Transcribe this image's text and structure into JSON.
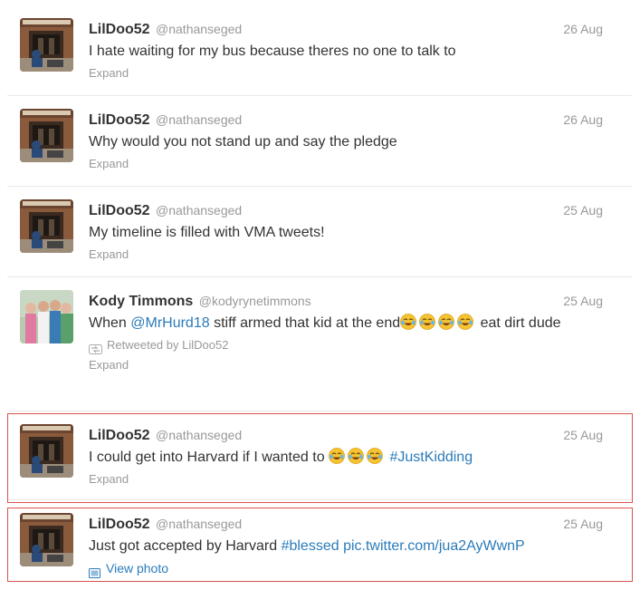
{
  "tweets": [
    {
      "fullname": "LilDoo52",
      "username": "@nathanseged",
      "time": "26 Aug",
      "text": "I hate waiting for my bus because theres no one to talk to",
      "action": "Expand"
    },
    {
      "fullname": "LilDoo52",
      "username": "@nathanseged",
      "time": "26 Aug",
      "text": "Why would you not stand up and say the pledge",
      "action": "Expand"
    },
    {
      "fullname": "LilDoo52",
      "username": "@nathanseged",
      "time": "25 Aug",
      "text": "My timeline is filled with VMA tweets!",
      "action": "Expand"
    },
    {
      "fullname": "Kody Timmons",
      "username": "@kodyrynetimmons",
      "time": "25 Aug",
      "text_before": "When ",
      "mention": "@MrHurd18",
      "text_after": " stiff armed that kid at the end",
      "text_tail": " eat dirt dude",
      "retweeted_by": "Retweeted by LilDoo52",
      "action": "Expand"
    },
    {
      "fullname": "LilDoo52",
      "username": "@nathanseged",
      "time": "25 Aug",
      "text_before": "I could get into Harvard if I wanted to ",
      "hashtag": "#JustKidding",
      "action": "Expand"
    },
    {
      "fullname": "LilDoo52",
      "username": "@nathanseged",
      "time": "25 Aug",
      "text_before": "Just got accepted by Harvard ",
      "hashtag": "#blessed",
      "link": "pic.twitter.com/jua2AyWwnP",
      "action": "View photo"
    }
  ],
  "colors": {
    "link": "#2b7bb9",
    "highlight": "#d9534f",
    "muted": "#999999"
  },
  "icons": {
    "retweet": "retweet-icon",
    "photo": "photo-icon",
    "emoji": "laughing-crying-emoji"
  }
}
